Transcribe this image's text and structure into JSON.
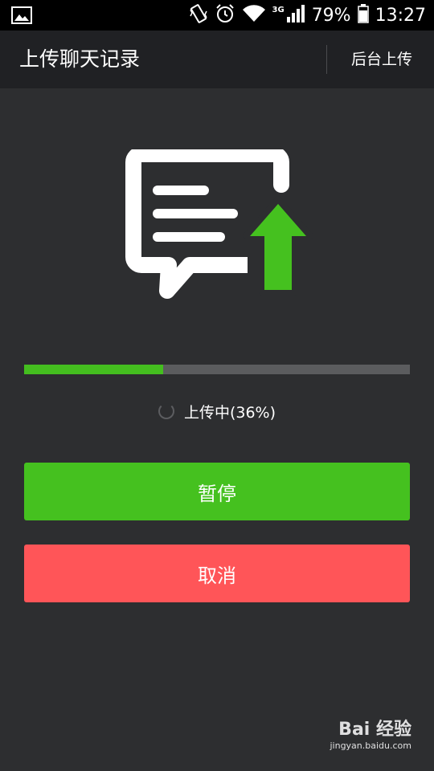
{
  "status_bar": {
    "battery": "79%",
    "time": "13:27",
    "network": "3G",
    "icons": [
      "gallery-icon",
      "vibrate-icon",
      "alarm-icon",
      "wifi-icon",
      "signal-icon",
      "battery-icon"
    ]
  },
  "header": {
    "title": "上传聊天记录",
    "background_upload_label": "后台上传"
  },
  "illustration": {
    "icon": "chat-upload-icon",
    "arrow_color": "#44be1f"
  },
  "progress": {
    "percent": 36,
    "status_text": "上传中(36%)"
  },
  "actions": {
    "pause_label": "暂停",
    "cancel_label": "取消"
  },
  "colors": {
    "background": "#2d2e30",
    "header": "#202124",
    "accent_green": "#45c11f",
    "cancel_red": "#ff5558"
  },
  "watermark": {
    "logo": "Bai 经验",
    "url": "jingyan.baidu.com"
  }
}
